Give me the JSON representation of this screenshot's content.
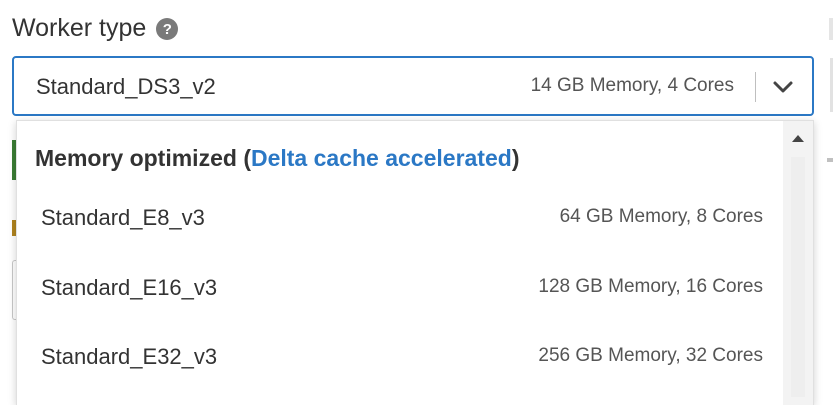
{
  "field": {
    "label": "Worker type",
    "help_icon": "question-circle-icon",
    "help_glyph": "?"
  },
  "select": {
    "value": "Standard_DS3_v2",
    "spec": "14 GB Memory, 4 Cores",
    "icon": "chevron-down-icon"
  },
  "dropdown": {
    "group": {
      "title": "Memory optimized",
      "open_paren": "(",
      "accent": "Delta cache accelerated",
      "close_paren": ")"
    },
    "items": [
      {
        "name": "Standard_E8_v3",
        "spec": "64 GB Memory, 8 Cores"
      },
      {
        "name": "Standard_E16_v3",
        "spec": "128 GB Memory, 16 Cores"
      },
      {
        "name": "Standard_E32_v3",
        "spec": "256 GB Memory, 32 Cores"
      }
    ]
  },
  "colors": {
    "accent": "#2b78c5",
    "text": "#333333",
    "muted": "#555555"
  }
}
